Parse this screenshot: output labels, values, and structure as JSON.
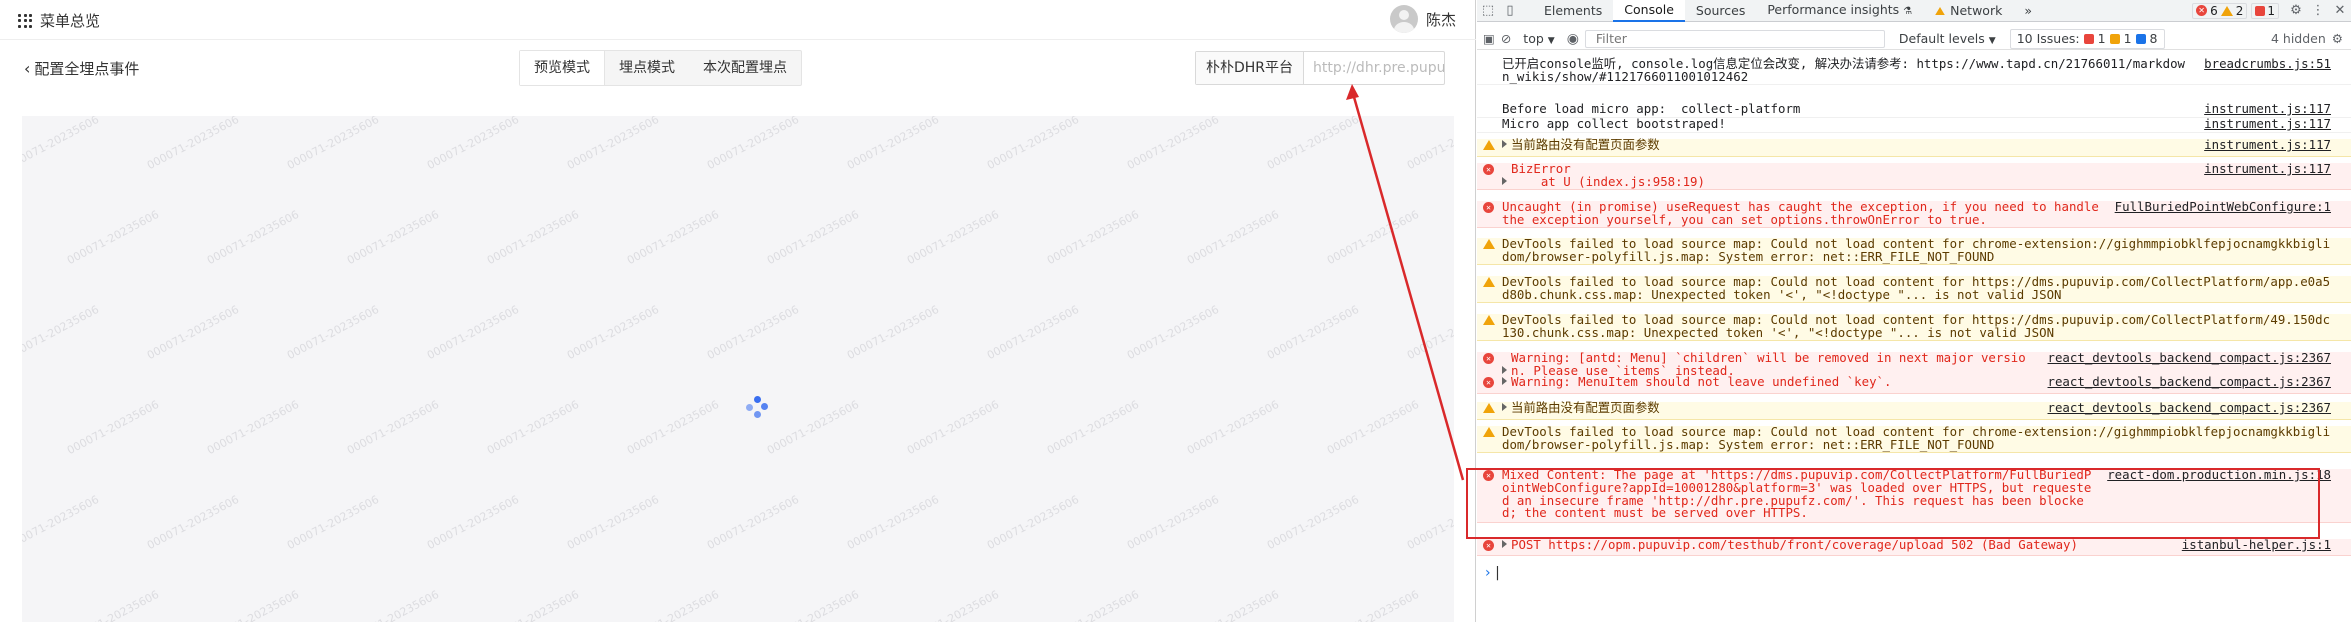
{
  "app": {
    "menu_label": "菜单总览",
    "user_name": "陈杰",
    "back_label": "配置全埋点事件",
    "modes": [
      "预览模式",
      "埋点模式",
      "本次配置埋点"
    ],
    "platform_label": "朴朴DHR平台",
    "platform_url_placeholder": "http://dhr.pre.pupu",
    "watermark": "000071-20235606"
  },
  "devtools": {
    "tabs": [
      "Elements",
      "Console",
      "Sources",
      "Performance insights",
      "Network"
    ],
    "active_tab": "Console",
    "counts": {
      "errors": "6",
      "warnings": "2",
      "info": "1"
    },
    "toolbar": {
      "context": "top",
      "filter_placeholder": "Filter",
      "levels": "Default levels",
      "issues_label": "10 Issues:",
      "issues_errors": "1",
      "issues_warnings": "1",
      "issues_info": "8",
      "hidden": "4 hidden"
    },
    "messages": [
      {
        "level": "info",
        "text": "已开启console监听, console.log信息定位会改变, 解决办法请参考: https://www.tapd.cn/21766011/markdown_wikis/show/#1121766011001012462",
        "source": "breadcrumbs.js:51"
      },
      {
        "level": "info",
        "text": "Before load micro app:  collect-platform",
        "source": "instrument.js:117"
      },
      {
        "level": "info",
        "text": "Micro app collect bootstraped!",
        "source": "instrument.js:117"
      },
      {
        "level": "warning",
        "text": "当前路由没有配置页面参数",
        "source": "instrument.js:117",
        "expandable": true
      },
      {
        "level": "error",
        "text": "BizError\n    at U (index.js:958:19)",
        "source": "instrument.js:117",
        "expandable": true
      },
      {
        "level": "error",
        "text": "Uncaught (in promise) useRequest has caught the exception, if you need to handle the exception yourself, you can set options.throwOnError to true.",
        "source": "FullBuriedPointWebConfigure:1"
      },
      {
        "level": "warning",
        "text": "DevTools failed to load source map: Could not load content for chrome-extension://gighmmpiobklfepjocnamgkkbiglidom/browser-polyfill.js.map: System error: net::ERR_FILE_NOT_FOUND",
        "source": ""
      },
      {
        "level": "warning",
        "text": "DevTools failed to load source map: Could not load content for https://dms.pupuvip.com/CollectPlatform/app.e0a5d80b.chunk.css.map: Unexpected token '<', \"<!doctype \"... is not valid JSON",
        "source": ""
      },
      {
        "level": "warning",
        "text": "DevTools failed to load source map: Could not load content for https://dms.pupuvip.com/CollectPlatform/49.150dc130.chunk.css.map: Unexpected token '<', \"<!doctype \"... is not valid JSON",
        "source": ""
      },
      {
        "level": "error",
        "text": "Warning: [antd: Menu] `children` will be removed in next major version. Please use `items` instead.",
        "source": "react_devtools_backend_compact.js:2367",
        "expandable": true
      },
      {
        "level": "error",
        "text": "Warning: MenuItem should not leave undefined `key`.",
        "source": "react_devtools_backend_compact.js:2367",
        "expandable": true
      },
      {
        "level": "warning",
        "text": "当前路由没有配置页面参数",
        "source": "react_devtools_backend_compact.js:2367",
        "expandable": true
      },
      {
        "level": "warning",
        "text": "DevTools failed to load source map: Could not load content for chrome-extension://gighmmpiobklfepjocnamgkkbiglidom/browser-polyfill.js.map: System error: net::ERR_FILE_NOT_FOUND",
        "source": ""
      },
      {
        "level": "error",
        "text": "Mixed Content: The page at 'https://dms.pupuvip.com/CollectPlatform/FullBuriedPointWebConfigure?appId=10001280&platform=3' was loaded over HTTPS, but requested an insecure frame 'http://dhr.pre.pupufz.com/'. This request has been blocked; the content must be served over HTTPS.",
        "source": "react-dom.production.min.js:18"
      },
      {
        "level": "error",
        "text": "POST https://opm.pupuvip.com/testhub/front/coverage/upload 502 (Bad Gateway)",
        "source": "istanbul-helper.js:1",
        "expandable": true
      }
    ]
  }
}
